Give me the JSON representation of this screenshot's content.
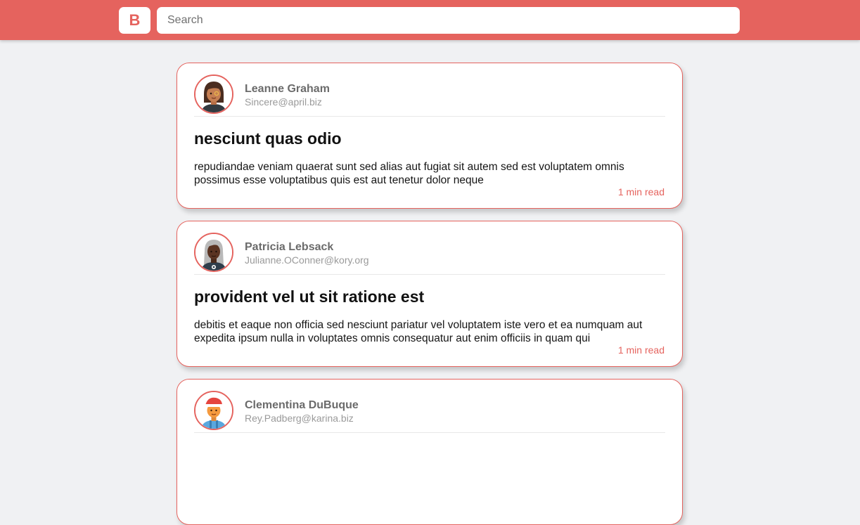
{
  "header": {
    "logo_letter": "B",
    "search_placeholder": "Search"
  },
  "colors": {
    "accent": "#e5635e",
    "background": "#f0f1f3",
    "card": "#ffffff"
  },
  "posts": [
    {
      "author_name": "Leanne Graham",
      "author_email": "Sincere@april.biz",
      "avatar_icon": "woman-brown-hair-avatar-icon",
      "title": "nesciunt quas odio",
      "body": "repudiandae veniam quaerat sunt sed alias aut fugiat sit autem sed est voluptatem omnis possimus esse voluptatibus quis est aut tenetur dolor neque",
      "read_time": "1 min read"
    },
    {
      "author_name": "Patricia Lebsack",
      "author_email": "Julianne.OConner@kory.org",
      "avatar_icon": "woman-grey-hair-avatar-icon",
      "title": "provident vel ut sit ratione est",
      "body": "debitis et eaque non officia sed nesciunt pariatur vel voluptatem iste vero et ea numquam aut expedita ipsum nulla in voluptates omnis consequatur aut enim officiis in quam qui",
      "read_time": "1 min read"
    },
    {
      "author_name": "Clementina DuBuque",
      "author_email": "Rey.Padberg@karina.biz",
      "avatar_icon": "child-santa-hat-avatar-icon",
      "title": "",
      "body": "",
      "read_time": ""
    }
  ]
}
